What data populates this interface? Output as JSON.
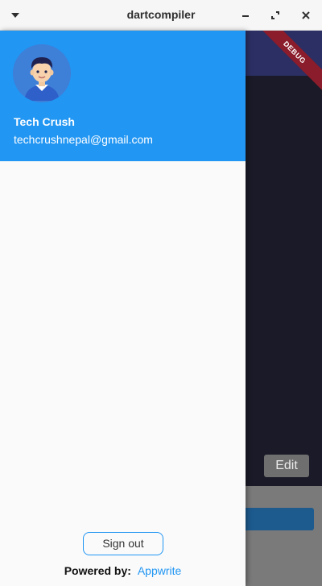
{
  "window": {
    "title": "dartcompiler",
    "controls": [
      "minimize-icon",
      "maximize-icon",
      "close-icon"
    ]
  },
  "app": {
    "edit_label": "Edit",
    "debug_banner": "DEBUG"
  },
  "drawer": {
    "user": {
      "name": "Tech Crush",
      "email": "techcrushnepal@gmail.com",
      "avatar_icon": "avatar-icon"
    },
    "signout_label": "Sign out",
    "powered_by_label": "Powered by:",
    "powered_by_brand": "Appwrite"
  },
  "colors": {
    "accent": "#2196f3",
    "appbar": "#2b2f63",
    "debug": "#8b1c2b"
  }
}
